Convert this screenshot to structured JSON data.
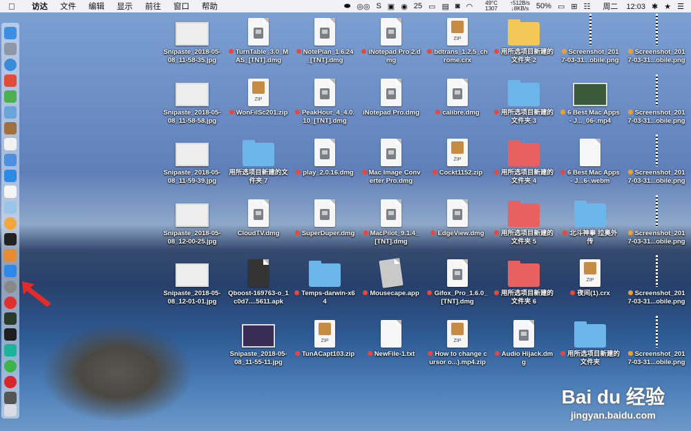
{
  "menubar": {
    "app": "访达",
    "items": [
      "文件",
      "编辑",
      "显示",
      "前往",
      "窗口",
      "帮助"
    ],
    "status": {
      "counter": "25",
      "cpu_temp": "49°C",
      "fan": "1307",
      "net_up": "↑512B/s",
      "net_down": "↓8KB/s",
      "battery": "50%",
      "day": "周二",
      "time": "12:03"
    }
  },
  "files": [
    {
      "label": "Snipaste_2018-05-08_11-58-35.jpg",
      "kind": "screenshot",
      "tag": ""
    },
    {
      "label": "TurnTable_3.0_MAS_[TNT].dmg",
      "kind": "dmg",
      "tag": "red"
    },
    {
      "label": "NotePlan_1.6.24_[TNT].dmg",
      "kind": "dmg",
      "tag": "red"
    },
    {
      "label": "iNotepad Pro 2.dmg",
      "kind": "dmg",
      "tag": "red"
    },
    {
      "label": "bdtrans_1.2.5_chrome.crx",
      "kind": "zip",
      "tag": "red"
    },
    {
      "label": "用所选项目新建的文件夹 2",
      "kind": "folder-yellow",
      "tag": "red"
    },
    {
      "label": "Screenshot_2017-03-31...obile.png",
      "kind": "strip",
      "tag": "orange"
    },
    {
      "label": "Screenshot_2017-03-31...obile.png",
      "kind": "strip",
      "tag": "orange"
    },
    {
      "label": "Snipaste_2018-05-08_11-58-58.jpg",
      "kind": "screenshot",
      "tag": ""
    },
    {
      "label": "WonFilSc201.zip",
      "kind": "zip",
      "tag": "red"
    },
    {
      "label": "PeakHour_4_4.0.10_[TNT].dmg",
      "kind": "dmg",
      "tag": "red"
    },
    {
      "label": "iNotepad Pro.dmg",
      "kind": "dmg",
      "tag": ""
    },
    {
      "label": "calibre.dmg",
      "kind": "dmg",
      "tag": "red"
    },
    {
      "label": "用所选项目新建的文件夹 3",
      "kind": "folder-blue",
      "tag": "red"
    },
    {
      "label": "6 Best Mac Apps- J..._06-.mp4",
      "kind": "video",
      "tag": "orange"
    },
    {
      "label": "Screenshot_2017-03-31...obile.png",
      "kind": "strip",
      "tag": "orange"
    },
    {
      "label": "Snipaste_2018-05-08_11-59-39.jpg",
      "kind": "screenshot",
      "tag": ""
    },
    {
      "label": "用所选项目新建的文件夹 7",
      "kind": "folder-blue",
      "tag": ""
    },
    {
      "label": "play_2.0.16.dmg",
      "kind": "dmg",
      "tag": "red"
    },
    {
      "label": "Mac Image Converter Pro.dmg",
      "kind": "dmg",
      "tag": "red"
    },
    {
      "label": "Cockt1152.zip",
      "kind": "zip",
      "tag": "red"
    },
    {
      "label": "用所选项目新建的文件夹 4",
      "kind": "folder-red",
      "tag": "red"
    },
    {
      "label": "6 Best Mac Apps- J...6-.webm",
      "kind": "webm",
      "tag": "red"
    },
    {
      "label": "Screenshot_2017-03-31...obile.png",
      "kind": "strip",
      "tag": "orange"
    },
    {
      "label": "Snipaste_2018-05-08_12-00-25.jpg",
      "kind": "screenshot",
      "tag": ""
    },
    {
      "label": "CloudTV.dmg",
      "kind": "dmg",
      "tag": ""
    },
    {
      "label": "SuperDuper.dmg",
      "kind": "dmg",
      "tag": "red"
    },
    {
      "label": "MacPilot_9.1.4_[TNT].dmg",
      "kind": "dmg",
      "tag": "red"
    },
    {
      "label": "EdgeView.dmg",
      "kind": "dmg",
      "tag": "red"
    },
    {
      "label": "用所选项目新建的文件夹 5",
      "kind": "folder-red",
      "tag": "red"
    },
    {
      "label": "北斗神拳 拉奥外传",
      "kind": "folder-blue",
      "tag": "red"
    },
    {
      "label": "Screenshot_2017-03-31...obile.png",
      "kind": "strip",
      "tag": "orange"
    },
    {
      "label": "Snipaste_2018-05-08_12-01-01.jpg",
      "kind": "screenshot",
      "tag": ""
    },
    {
      "label": "Qboost-169763-o_1c0d7....5611.apk",
      "kind": "apk",
      "tag": ""
    },
    {
      "label": "Temps-darwin-x64",
      "kind": "folder-blue",
      "tag": "red"
    },
    {
      "label": "Mousecape.app",
      "kind": "app",
      "tag": "red"
    },
    {
      "label": "Gifox_Pro_1.6.0_[TNT].dmg",
      "kind": "dmg",
      "tag": "red"
    },
    {
      "label": "用所选项目新建的文件夹 6",
      "kind": "folder-red",
      "tag": "red"
    },
    {
      "label": "夜间(1).crx",
      "kind": "zip",
      "tag": "red"
    },
    {
      "label": "Screenshot_2017-03-31...obile.png",
      "kind": "strip",
      "tag": "orange"
    },
    {
      "label": "",
      "kind": "none",
      "tag": ""
    },
    {
      "label": "Snipaste_2018-05-08_11-55-11.jpg",
      "kind": "screenshot-dark",
      "tag": ""
    },
    {
      "label": "TunACapt103.zip",
      "kind": "zip",
      "tag": "red"
    },
    {
      "label": "NewFile-1.txt",
      "kind": "txt",
      "tag": "red"
    },
    {
      "label": "How to change cursor o...).mp4.zip",
      "kind": "zip",
      "tag": "red"
    },
    {
      "label": "Audio Hijack.dmg",
      "kind": "dmg",
      "tag": "red"
    },
    {
      "label": "用所选项目新建的文件夹",
      "kind": "folder-blue",
      "tag": "red"
    },
    {
      "label": "Screenshot_2017-03-31...obile.png",
      "kind": "strip",
      "tag": "orange"
    }
  ],
  "watermark": {
    "main": "Bai du 经验",
    "sub": "jingyan.baidu.com"
  },
  "colors": {
    "red": "#e8473d",
    "orange": "#f0a02a",
    "folder_blue": "#6cb6ec",
    "folder_yellow": "#f3c856",
    "folder_red": "#e86060"
  }
}
